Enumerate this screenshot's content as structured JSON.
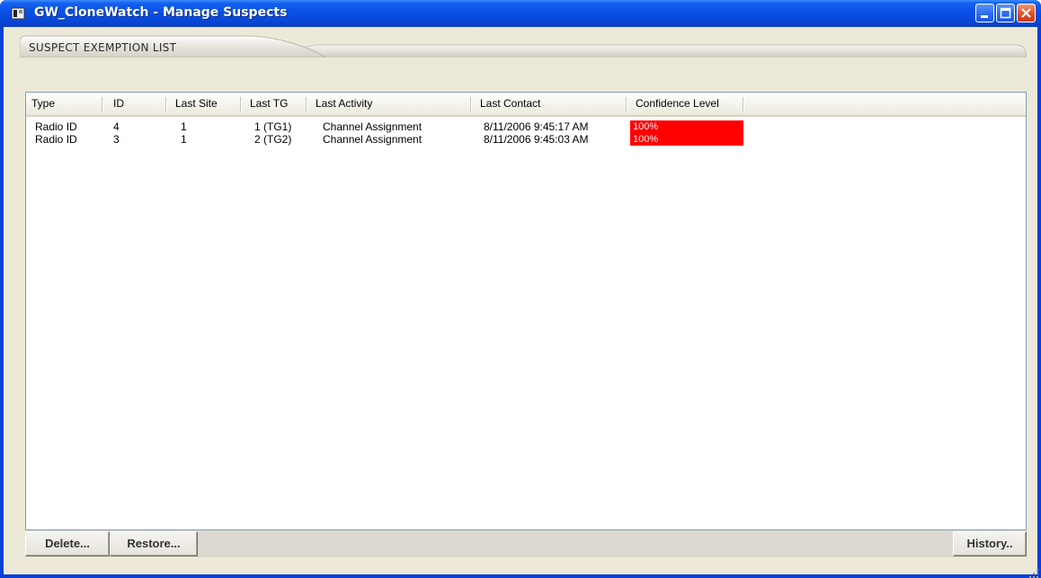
{
  "window": {
    "title": "GW_CloneWatch - Manage Suspects",
    "icon": "app-icon",
    "controls": [
      "minimize-icon",
      "maximize-icon",
      "close-icon"
    ]
  },
  "tab": {
    "label": "SUSPECT EXEMPTION LIST"
  },
  "table": {
    "columns": [
      "Type",
      "ID",
      "Last Site",
      "Last TG",
      "Last Activity",
      "Last Contact",
      "Confidence Level"
    ],
    "rows": [
      {
        "type": "Radio ID",
        "id": "4",
        "last_site": "1",
        "last_tg": "1 (TG1)",
        "last_activity": "Channel Assignment",
        "last_contact": "8/11/2006 9:45:17 AM",
        "confidence": "100%"
      },
      {
        "type": "Radio ID",
        "id": "3",
        "last_site": "1",
        "last_tg": "2 (TG2)",
        "last_activity": "Channel Assignment",
        "last_contact": "8/11/2006 9:45:03 AM",
        "confidence": "100%"
      }
    ]
  },
  "buttons": {
    "delete": "Delete...",
    "restore": "Restore...",
    "history": "History.."
  },
  "colors": {
    "titlebar": "#0a52e6",
    "confidence_high": "#ff0000",
    "client_bg": "#ece9d8"
  }
}
